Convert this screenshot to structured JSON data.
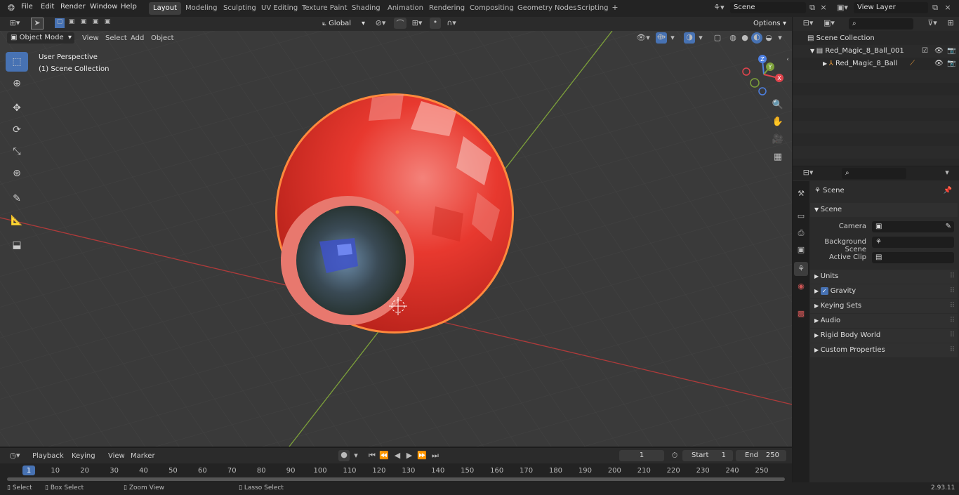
{
  "topbar": {
    "menus": [
      "File",
      "Edit",
      "Render",
      "Window",
      "Help"
    ],
    "workspaces": [
      "Layout",
      "Modeling",
      "Sculpting",
      "UV Editing",
      "Texture Paint",
      "Shading",
      "Animation",
      "Rendering",
      "Compositing",
      "Geometry Nodes",
      "Scripting"
    ],
    "active_workspace": "Layout",
    "scene": "Scene",
    "view_layer": "View Layer"
  },
  "viewport_header": {
    "mode": "Object Mode",
    "menus": [
      "View",
      "Select",
      "Add",
      "Object"
    ],
    "orientation": "Global",
    "options": "Options"
  },
  "viewport": {
    "perspective": "User Perspective",
    "collection": "(1) Scene Collection",
    "gizmo": {
      "z": "Z",
      "y": "Y",
      "x": "X"
    }
  },
  "outliner": {
    "root": "Scene Collection",
    "items": [
      {
        "label": "Red_Magic_8_Ball_001",
        "level": 1
      },
      {
        "label": "Red_Magic_8_Ball",
        "level": 2
      }
    ]
  },
  "properties": {
    "header": "Scene",
    "panel": "Scene",
    "fields": [
      {
        "label": "Camera",
        "value": ""
      },
      {
        "label": "Background Scene",
        "value": ""
      },
      {
        "label": "Active Clip",
        "value": ""
      }
    ],
    "subpanels": [
      "Units",
      "Gravity",
      "Keying Sets",
      "Audio",
      "Rigid Body World",
      "Custom Properties"
    ]
  },
  "timeline": {
    "menus": [
      "Playback",
      "Keying",
      "View",
      "Marker"
    ],
    "current_frame": "1",
    "start_label": "Start",
    "start": "1",
    "end_label": "End",
    "end": "250",
    "ticks": [
      "1",
      "10",
      "20",
      "30",
      "40",
      "50",
      "60",
      "70",
      "80",
      "90",
      "100",
      "110",
      "120",
      "130",
      "140",
      "150",
      "160",
      "170",
      "180",
      "190",
      "200",
      "210",
      "220",
      "230",
      "240",
      "250"
    ]
  },
  "statusbar": {
    "select": "Select",
    "box_select": "Box Select",
    "zoom_view": "Zoom View",
    "lasso_select": "Lasso Select",
    "version": "2.93.11"
  },
  "colors": {
    "accent": "#4772b3",
    "ball": "#e8392f",
    "selection_outline": "#ff8a3d",
    "x_axis": "#b03a3a",
    "y_axis": "#7da13a"
  }
}
